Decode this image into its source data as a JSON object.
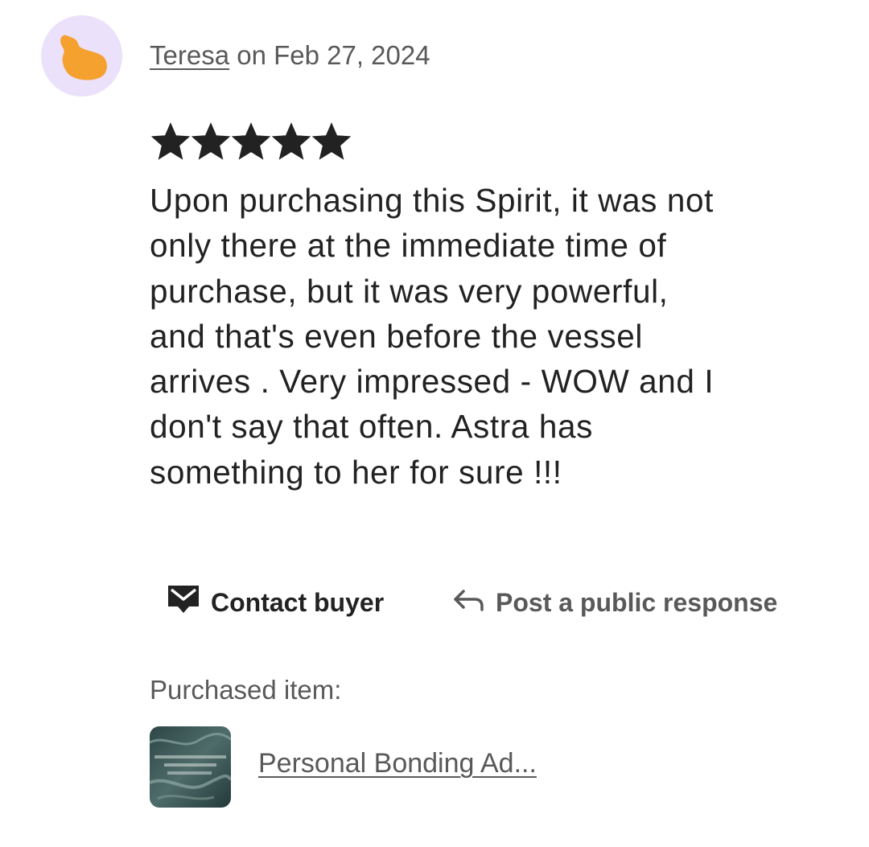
{
  "review": {
    "author": "Teresa",
    "date_text": "on Feb 27, 2024",
    "rating": 5,
    "rating_max": 5,
    "text_lines": [
      "Upon purchasing this Spirit, it was not",
      "only there at the immediate time of",
      "purchase, but it was very powerful,",
      "and that's even before the vessel",
      "arrives . Very impressed - WOW and I",
      "don't say that often. Astra has",
      "something to her for sure !!!"
    ]
  },
  "avatar": {
    "icon": "person-blob-icon",
    "background_color": "#ebe1fb",
    "icon_color": "#f4a12f"
  },
  "actions": {
    "contact_label": "Contact buyer",
    "contact_icon": "mail-icon",
    "respond_label": "Post a public response",
    "respond_icon": "reply-arrow-icon"
  },
  "purchase": {
    "label": "Purchased item:",
    "item_title": "Personal Bonding Ad...",
    "thumbnail_icon": "listing-thumbnail-image"
  },
  "colors": {
    "primary_text": "#222222",
    "secondary_text": "#595959",
    "star": "#222222"
  }
}
